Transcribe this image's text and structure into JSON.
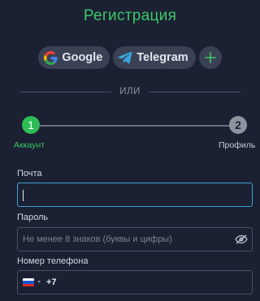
{
  "title": "Регистрация",
  "social": {
    "google_label": "Google",
    "telegram_label": "Telegram",
    "add_icon": "plus-icon"
  },
  "divider_text": "ИЛИ",
  "steps": [
    {
      "number": "1",
      "label": "Аккаунт",
      "state": "active",
      "color": "#2ebd55"
    },
    {
      "number": "2",
      "label": "Профиль",
      "state": "inactive",
      "color": "#8e939f"
    }
  ],
  "form": {
    "email": {
      "label": "Почта",
      "value": ""
    },
    "password": {
      "label": "Пароль",
      "placeholder": "Не менее 8 знаков (буквы и цифры)",
      "value": ""
    },
    "phone": {
      "label": "Номер телефона",
      "country_code": "+7",
      "country_flag": "russia-flag-icon"
    }
  },
  "colors": {
    "background": "#1b2033",
    "accent_green": "#3cc765",
    "focus_border": "#3aa3d2",
    "button_bg": "#3b4154"
  }
}
